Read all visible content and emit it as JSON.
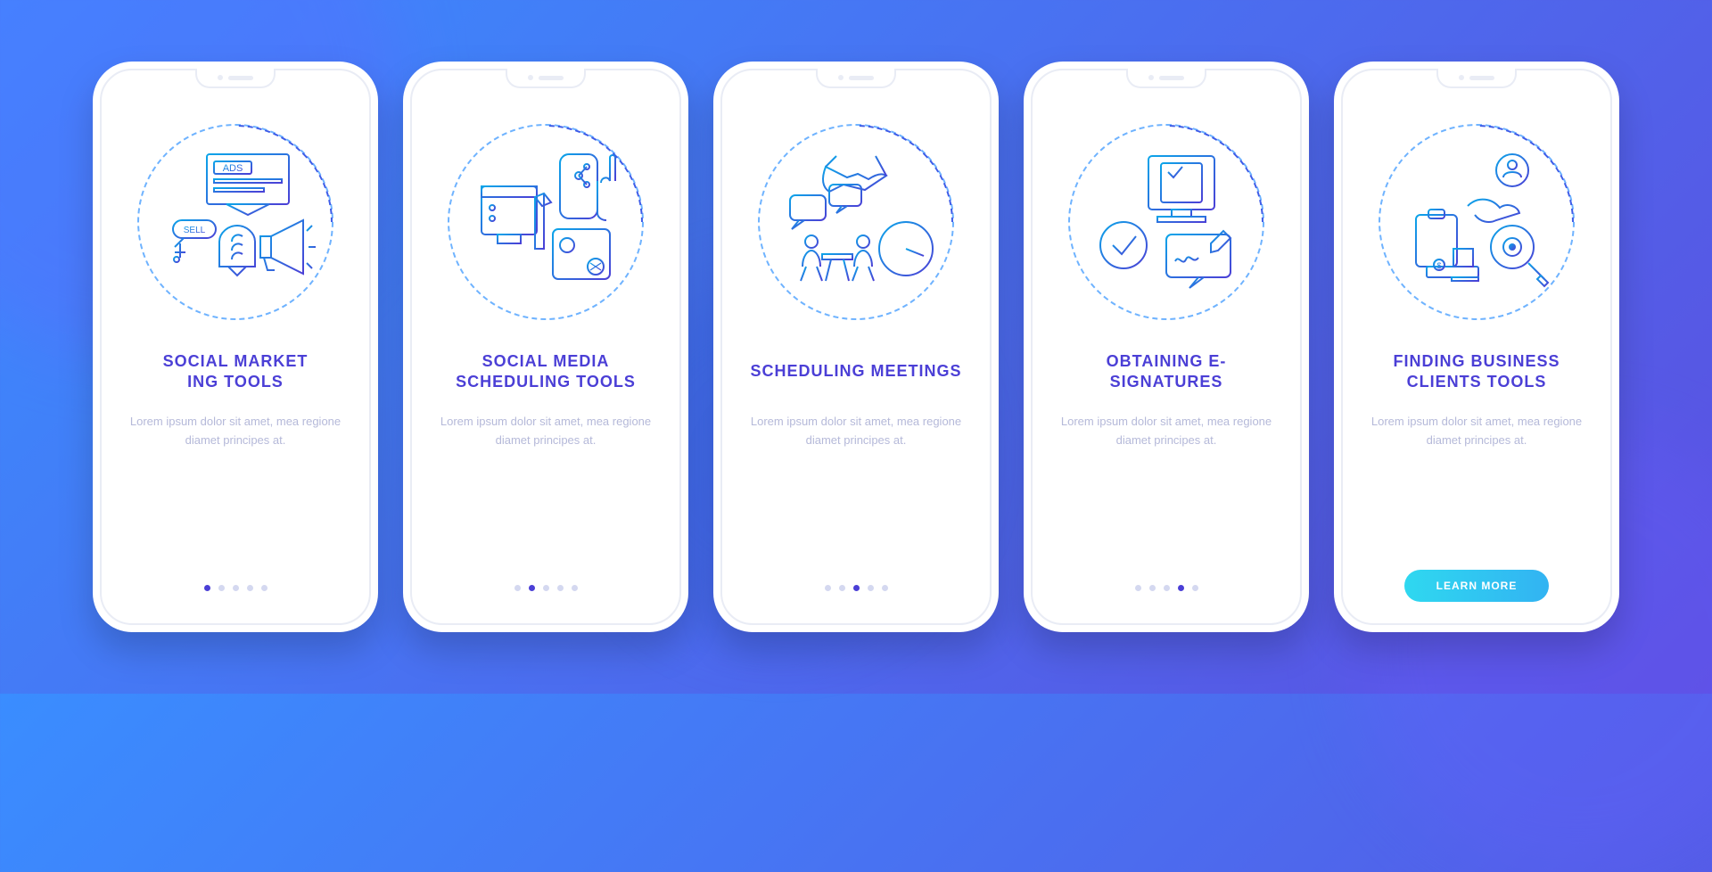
{
  "screens": [
    {
      "title": "SOCIAL MARKET\nING TOOLS",
      "desc": "Lorem ipsum dolor sit amet, mea regione diamet principes at.",
      "icon": "marketing"
    },
    {
      "title": "SOCIAL MEDIA SCHEDULING TOOLS",
      "desc": "Lorem ipsum dolor sit amet, mea regione diamet principes at.",
      "icon": "social"
    },
    {
      "title": "SCHEDULING MEETINGS",
      "desc": "Lorem ipsum dolor sit amet, mea regione diamet principes at.",
      "icon": "meeting"
    },
    {
      "title": "OBTAINING E-SIGNATURES",
      "desc": "Lorem ipsum dolor sit amet, mea regione diamet principes at.",
      "icon": "esign"
    },
    {
      "title": "FINDING BUSINESS CLIENTS TOOLS",
      "desc": "Lorem ipsum dolor sit amet, mea regione diamet principes at.",
      "icon": "clients"
    }
  ],
  "cta": "LEARN MORE",
  "icon_labels": {
    "ads": "ADS",
    "sell": "SELL"
  },
  "colors": {
    "accent": "#4B3FD6",
    "cta_a": "#2FD8F0",
    "cta_b": "#32B3F2"
  }
}
